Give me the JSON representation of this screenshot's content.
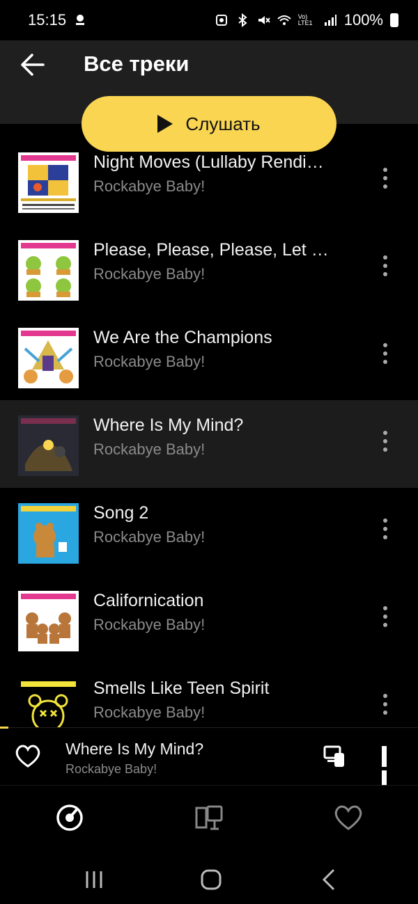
{
  "status_bar": {
    "time": "15:15",
    "battery": "100%",
    "network_label": "Vo) LTE1"
  },
  "header": {
    "title": "Все треки"
  },
  "play_button": {
    "label": "Слушать"
  },
  "tracks": [
    {
      "title": "Night Moves (Lullaby Rendi…",
      "artist": "Rockabye Baby!",
      "cover": "cover-good-day-goodnight"
    },
    {
      "title": "Please, Please, Please, Let …",
      "artist": "Rockabye Baby!",
      "cover": "cover-smiths"
    },
    {
      "title": "We Are the Champions",
      "artist": "Rockabye Baby!",
      "cover": "cover-queen"
    },
    {
      "title": "Where Is My Mind?",
      "artist": "Rockabye Baby!",
      "cover": "cover-pixies",
      "active": true
    },
    {
      "title": "Song 2",
      "artist": "Rockabye Baby!",
      "cover": "cover-blur"
    },
    {
      "title": "Californication",
      "artist": "Rockabye Baby!",
      "cover": "cover-red-hot-chili-peppers"
    },
    {
      "title": "Smells Like Teen Spirit",
      "artist": "Rockabye Baby!",
      "cover": "cover-nirvana"
    }
  ],
  "mini_player": {
    "title": "Where Is My Mind?",
    "artist": "Rockabye Baby!",
    "progress": 0.02
  },
  "colors": {
    "accent": "#fad552",
    "background": "#000000",
    "header_bg": "#1f1f1f",
    "active_row_bg": "#1c1c1c",
    "secondary_text": "#8a8a8a"
  }
}
